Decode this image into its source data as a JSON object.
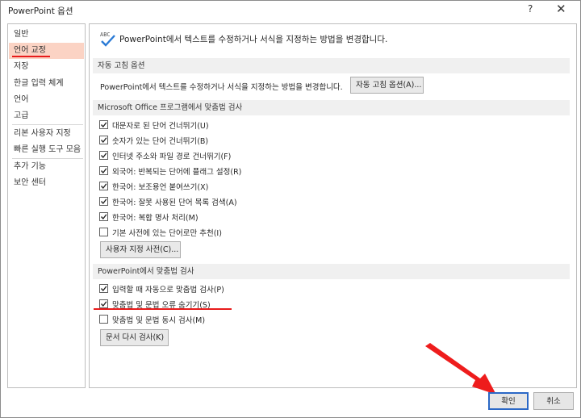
{
  "window": {
    "title": "PowerPoint 옵션",
    "help_glyph": "?",
    "close_glyph": "✕"
  },
  "sidebar": {
    "items": [
      {
        "label": "일반"
      },
      {
        "label": "언어 교정",
        "selected": true
      },
      {
        "label": "저장"
      },
      {
        "label": "한글 입력 체계"
      },
      {
        "label": "언어"
      },
      {
        "label": "고급"
      },
      {
        "label": "리본 사용자 지정"
      },
      {
        "label": "빠른 실행 도구 모음"
      },
      {
        "label": "추가 기능"
      },
      {
        "label": "보안 센터"
      }
    ]
  },
  "main": {
    "icon": "abc-check-icon",
    "icon_text": "ABC",
    "header": "PowerPoint에서 텍스트를 수정하거나 서식을 지정하는 방법을 변경합니다.",
    "autocorrect": {
      "section_title": "자동 고침 옵션",
      "description": "PowerPoint에서 텍스트를 수정하거나 서식을 지정하는 방법을 변경합니다.",
      "button": "자동 고침 옵션(A)..."
    },
    "office_spelling": {
      "section_title": "Microsoft Office 프로그램에서 맞춤법 검사",
      "options": [
        {
          "label": "대문자로 된 단어 건너뛰기(U)",
          "checked": true
        },
        {
          "label": "숫자가 있는 단어 건너뛰기(B)",
          "checked": true
        },
        {
          "label": "인터넷 주소와 파일 경로 건너뛰기(F)",
          "checked": true
        },
        {
          "label": "외국어: 반복되는 단어에 플래그 설정(R)",
          "checked": true
        },
        {
          "label": "한국어: 보조용언 붙여쓰기(X)",
          "checked": true
        },
        {
          "label": "한국어: 잘못 사용된 단어 목록 검색(A)",
          "checked": true
        },
        {
          "label": "한국어: 복합 명사 처리(M)",
          "checked": true
        },
        {
          "label": "기본 사전에 있는 단어로만 추천(I)",
          "checked": false
        }
      ],
      "button": "사용자 지정 사전(C)..."
    },
    "ppt_spelling": {
      "section_title": "PowerPoint에서 맞춤법 검사",
      "options": [
        {
          "label": "입력할 때 자동으로 맞춤법 검사(P)",
          "checked": true
        },
        {
          "label": "맞춤법 및 문법 오류 숨기기(S)",
          "checked": true
        },
        {
          "label": "맞춤법 및 문법 동시 검사(M)",
          "checked": false
        }
      ],
      "button": "문서 다시 검사(K)"
    }
  },
  "footer": {
    "ok": "확인",
    "cancel": "취소"
  },
  "colors": {
    "selected_bg": "#fbd3c4",
    "annotation_red": "#e81b1b",
    "default_button_border": "#2b68c6"
  }
}
